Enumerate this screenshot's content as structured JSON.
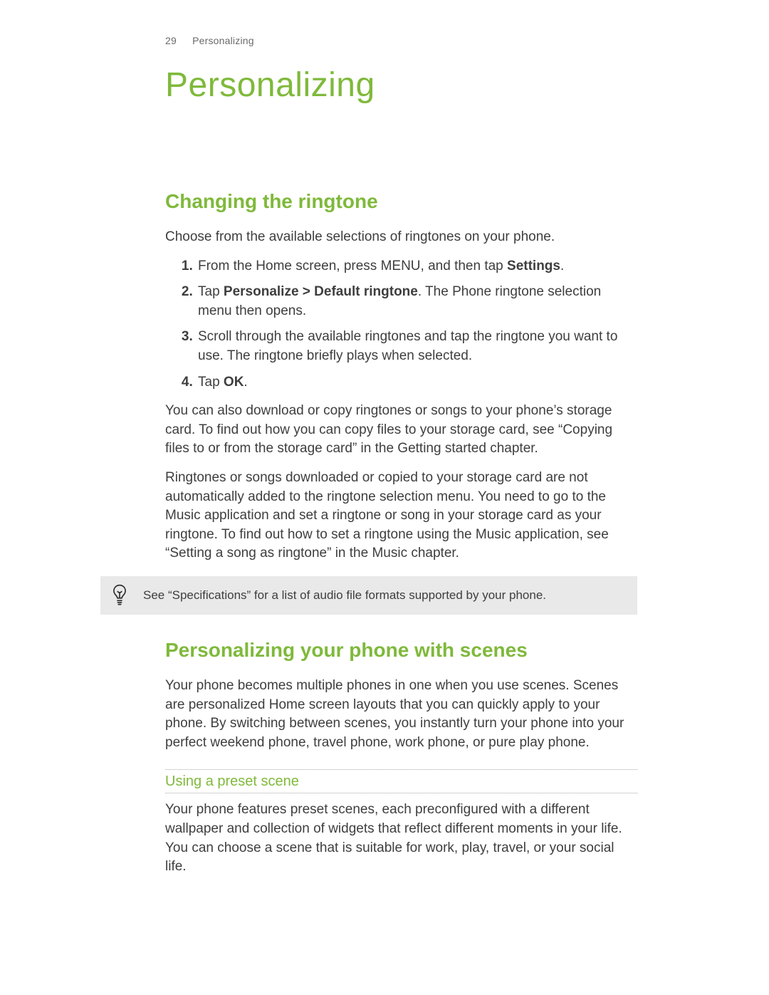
{
  "header": {
    "page_number": "29",
    "section_name": "Personalizing"
  },
  "chapter_title": "Personalizing",
  "section1": {
    "title": "Changing the ringtone",
    "intro": "Choose from the available selections of ringtones on your phone.",
    "steps": {
      "s1_pre": "From the Home screen, press MENU, and then tap ",
      "s1_bold": "Settings",
      "s1_post": ".",
      "s2_pre": "Tap ",
      "s2_bold": "Personalize > Default ringtone",
      "s2_post": ". The Phone ringtone selection menu then opens.",
      "s3": "Scroll through the available ringtones and tap the ringtone you want to use. The ringtone briefly plays when selected.",
      "s4_pre": "Tap ",
      "s4_bold": "OK",
      "s4_post": "."
    },
    "para2": "You can also download or copy ringtones or songs to your phone’s storage card. To find out how you can copy files to your storage card, see “Copying files to or from the storage card” in the Getting started chapter.",
    "para3": "Ringtones or songs downloaded or copied to your storage card are not automatically added to the ringtone selection menu. You need to go to the Music application and set a ringtone or song in your storage card as your ringtone. To find out how to set a ringtone using the Music application, see “Setting a song as ringtone” in the Music chapter.",
    "tip": "See “Specifications” for a list of audio file formats supported by your phone."
  },
  "section2": {
    "title": "Personalizing your phone with scenes",
    "intro": "Your phone becomes multiple phones in one when you use scenes. Scenes are personalized Home screen layouts that you can quickly apply to your phone. By switching between scenes, you instantly turn your phone into your perfect weekend phone, travel phone, work phone, or pure play phone.",
    "subsection_title": "Using a preset scene",
    "subsection_body": "Your phone features preset scenes, each preconfigured with a different wallpaper and collection of widgets that reflect different moments in your life. You can choose a scene that is suitable for work, play, travel, or your social life."
  }
}
